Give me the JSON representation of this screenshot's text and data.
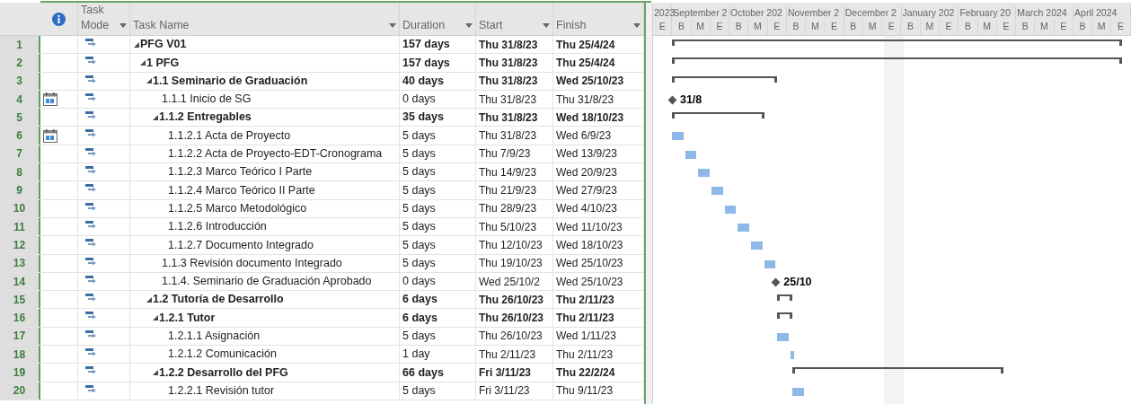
{
  "columns": [
    {
      "kind": "info"
    },
    {
      "kind": "mode",
      "label": "Task Mode"
    },
    {
      "kind": "name",
      "label": "Task Name"
    },
    {
      "kind": "duration",
      "label": "Duration"
    },
    {
      "kind": "start",
      "label": "Start"
    },
    {
      "kind": "finish",
      "label": "Finish"
    }
  ],
  "timescale": {
    "months": [
      "2023",
      "September 2",
      "October 202",
      "November 2",
      "December 2",
      "January 202",
      "February 20",
      "March 2024",
      "April 2024"
    ],
    "periods": [
      "E",
      "B",
      "M",
      "E",
      "B",
      "M",
      "E",
      "B",
      "M",
      "E",
      "B",
      "M",
      "E",
      "B",
      "M",
      "E",
      "B",
      "M",
      "E",
      "B",
      "M",
      "E",
      "B",
      "M",
      "E"
    ]
  },
  "tasks": [
    {
      "id": "1",
      "name": "PFG V01",
      "duration": "157 days",
      "start": "Thu 31/8/23",
      "finish": "Thu 25/4/24",
      "kind": "summary",
      "expanded": true,
      "calendar_indicator": false,
      "children": [
        {
          "id": "2",
          "name": "1 PFG",
          "duration": "157 days",
          "start": "Thu 31/8/23",
          "finish": "Thu 25/4/24",
          "kind": "summary",
          "expanded": true,
          "calendar_indicator": false,
          "children": [
            {
              "id": "3",
              "name": "1.1 Seminario de Graduación",
              "duration": "40 days",
              "start": "Thu 31/8/23",
              "finish": "Wed 25/10/23",
              "kind": "summary",
              "expanded": true,
              "calendar_indicator": false,
              "children": [
                {
                  "id": "4",
                  "name": "1.1.1 Inicio de SG",
                  "duration": "0 days",
                  "start": "Thu 31/8/23",
                  "finish": "Thu 31/8/23",
                  "kind": "milestone",
                  "bar_label": "31/8",
                  "calendar_indicator": true
                },
                {
                  "id": "5",
                  "name": "1.1.2 Entregables",
                  "duration": "35 days",
                  "start": "Thu 31/8/23",
                  "finish": "Wed 18/10/23",
                  "kind": "summary",
                  "expanded": true,
                  "calendar_indicator": false,
                  "children": [
                    {
                      "id": "6",
                      "name": "1.1.2.1 Acta de Proyecto",
                      "duration": "5 days",
                      "start": "Thu 31/8/23",
                      "finish": "Wed 6/9/23",
                      "kind": "task",
                      "calendar_indicator": true
                    },
                    {
                      "id": "7",
                      "name": "1.1.2.2 Acta de Proyecto-EDT-Cronograma",
                      "duration": "5 days",
                      "start": "Thu 7/9/23",
                      "finish": "Wed 13/9/23",
                      "kind": "task",
                      "calendar_indicator": false
                    },
                    {
                      "id": "8",
                      "name": "1.1.2.3 Marco Teórico I Parte",
                      "duration": "5 days",
                      "start": "Thu 14/9/23",
                      "finish": "Wed 20/9/23",
                      "kind": "task",
                      "calendar_indicator": false
                    },
                    {
                      "id": "9",
                      "name": "1.1.2.4 Marco Teórico II Parte",
                      "duration": "5 days",
                      "start": "Thu 21/9/23",
                      "finish": "Wed 27/9/23",
                      "kind": "task",
                      "calendar_indicator": false
                    },
                    {
                      "id": "10",
                      "name": "1.1.2.5 Marco Metodológico",
                      "duration": "5 days",
                      "start": "Thu 28/9/23",
                      "finish": "Wed 4/10/23",
                      "kind": "task",
                      "calendar_indicator": false
                    },
                    {
                      "id": "11",
                      "name": "1.1.2.6 Introducción",
                      "duration": "5 days",
                      "start": "Thu 5/10/23",
                      "finish": "Wed 11/10/23",
                      "kind": "task",
                      "calendar_indicator": false
                    },
                    {
                      "id": "12",
                      "name": "1.1.2.7 Documento Integrado",
                      "duration": "5 days",
                      "start": "Thu 12/10/23",
                      "finish": "Wed 18/10/23",
                      "kind": "task",
                      "calendar_indicator": false
                    }
                  ]
                },
                {
                  "id": "13",
                  "name": "1.1.3 Revisión documento Integrado",
                  "duration": "5 days",
                  "start": "Thu 19/10/23",
                  "finish": "Wed 25/10/23",
                  "kind": "task",
                  "calendar_indicator": false
                },
                {
                  "id": "14",
                  "name": "1.1.4. Seminario de Graduación Aprobado",
                  "duration": "0 days",
                  "start": "Wed 25/10/2",
                  "finish": "Wed 25/10/23",
                  "kind": "milestone",
                  "bar_label": "25/10",
                  "calendar_indicator": false
                }
              ]
            },
            {
              "id": "15",
              "name": "1.2 Tutoría de Desarrollo",
              "duration": "6 days",
              "start": "Thu 26/10/23",
              "finish": "Thu 2/11/23",
              "kind": "summary",
              "expanded": true,
              "calendar_indicator": false,
              "children": [
                {
                  "id": "16",
                  "name": "1.2.1 Tutor",
                  "duration": "6 days",
                  "start": "Thu 26/10/23",
                  "finish": "Thu 2/11/23",
                  "kind": "summary",
                  "expanded": true,
                  "calendar_indicator": false,
                  "children": [
                    {
                      "id": "17",
                      "name": "1.2.1.1 Asignación",
                      "duration": "5 days",
                      "start": "Thu 26/10/23",
                      "finish": "Wed 1/11/23",
                      "kind": "task",
                      "calendar_indicator": false
                    },
                    {
                      "id": "18",
                      "name": "1.2.1.2 Comunicación",
                      "duration": "1 day",
                      "start": "Thu 2/11/23",
                      "finish": "Thu 2/11/23",
                      "kind": "task",
                      "calendar_indicator": false
                    }
                  ]
                },
                {
                  "id": "19",
                  "name": "1.2.2 Desarrollo del PFG",
                  "duration": "66 days",
                  "start": "Fri 3/11/23",
                  "finish": "Thu 22/2/24",
                  "kind": "summary",
                  "expanded": true,
                  "calendar_indicator": false,
                  "children": [
                    {
                      "id": "20",
                      "name": "1.2.2.1 Revisión tutor",
                      "duration": "5 days",
                      "start": "Fri 3/11/23",
                      "finish": "Thu 9/11/23",
                      "kind": "task",
                      "calendar_indicator": false
                    }
                  ]
                }
              ]
            }
          ]
        }
      ]
    }
  ]
}
